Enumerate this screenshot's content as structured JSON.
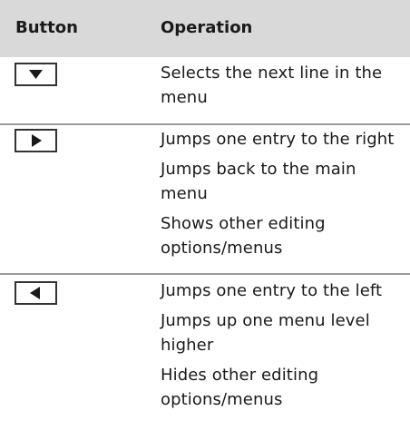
{
  "header": {
    "button_col": "Button",
    "operation_col": "Operation"
  },
  "rows": [
    {
      "button_icon": "down-arrow-key-icon",
      "operations": [
        "Selects the next line in the menu"
      ]
    },
    {
      "button_icon": "right-arrow-key-icon",
      "operations": [
        "Jumps one entry to the right",
        "Jumps back to the main menu",
        "Shows other editing options/menus"
      ]
    },
    {
      "button_icon": "left-arrow-key-icon",
      "operations": [
        "Jumps one entry to the left",
        "Jumps up one menu level higher",
        "Hides other editing options/menus"
      ]
    }
  ],
  "colors": {
    "header_bg": "#d9d9d9",
    "divider": "#9a9a9a"
  }
}
